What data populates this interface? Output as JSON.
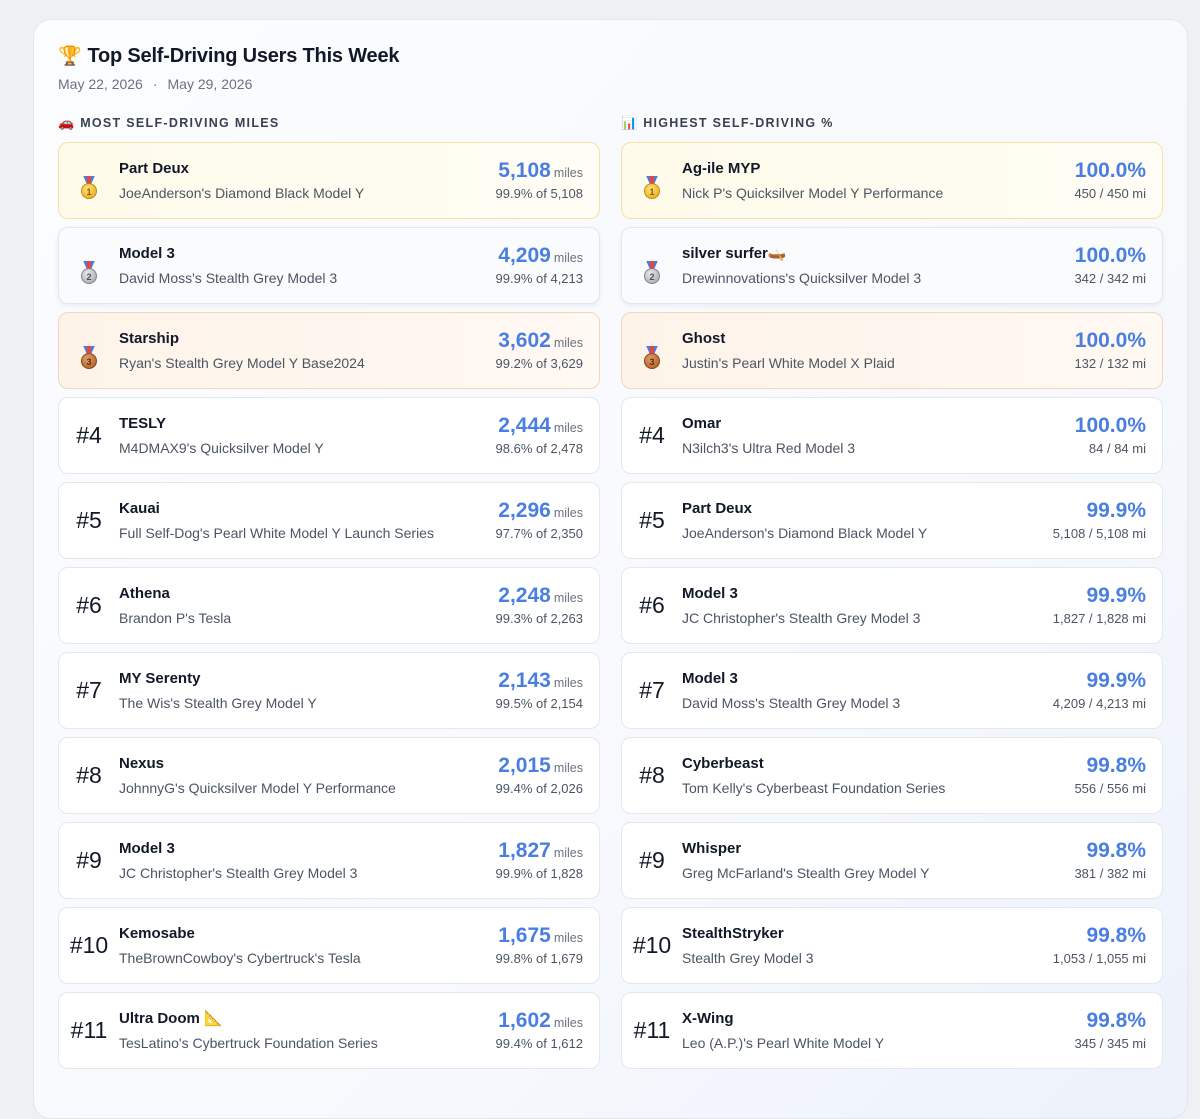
{
  "header": {
    "title": "Top Self-Driving Users This Week",
    "trophy_icon": "🏆",
    "date_start": "May 22, 2026",
    "date_sep": "·",
    "date_end": "May 29, 2026"
  },
  "miles": {
    "heading_icon": "🚗",
    "heading": "MOST SELF-DRIVING MILES",
    "unit": "miles",
    "rows": [
      {
        "rank": "1",
        "name": "Part Deux",
        "sub": "JoeAnderson's Diamond Black Model Y",
        "big": "5,108",
        "small": "99.9% of 5,108"
      },
      {
        "rank": "2",
        "name": "Model 3",
        "sub": "David Moss's Stealth Grey Model 3",
        "big": "4,209",
        "small": "99.9% of 4,213"
      },
      {
        "rank": "3",
        "name": "Starship",
        "sub": "Ryan's Stealth Grey Model Y Base2024",
        "big": "3,602",
        "small": "99.2% of 3,629"
      },
      {
        "rank": "#4",
        "name": "TESLY",
        "sub": "M4DMAX9's Quicksilver Model Y",
        "big": "2,444",
        "small": "98.6% of 2,478"
      },
      {
        "rank": "#5",
        "name": "Kauai",
        "sub": "Full Self-Dog's Pearl White Model Y Launch Series",
        "big": "2,296",
        "small": "97.7% of 2,350"
      },
      {
        "rank": "#6",
        "name": "Athena",
        "sub": "Brandon P's Tesla",
        "big": "2,248",
        "small": "99.3% of 2,263"
      },
      {
        "rank": "#7",
        "name": "MY Serenty",
        "sub": "The Wis's Stealth Grey Model Y",
        "big": "2,143",
        "small": "99.5% of 2,154"
      },
      {
        "rank": "#8",
        "name": "Nexus",
        "sub": "JohnnyG's Quicksilver Model Y Performance",
        "big": "2,015",
        "small": "99.4% of 2,026"
      },
      {
        "rank": "#9",
        "name": "Model 3",
        "sub": "JC Christopher's Stealth Grey Model 3",
        "big": "1,827",
        "small": "99.9% of 1,828"
      },
      {
        "rank": "#10",
        "name": "Kemosabe",
        "sub": "TheBrownCowboy's Cybertruck's Tesla",
        "big": "1,675",
        "small": "99.8% of 1,679"
      },
      {
        "rank": "#11",
        "name": "Ultra Doom 📐",
        "sub": "TesLatino's Cybertruck Foundation Series",
        "big": "1,602",
        "small": "99.4% of 1,612"
      }
    ]
  },
  "percent": {
    "heading_icon": "📊",
    "heading": "HIGHEST SELF-DRIVING %",
    "rows": [
      {
        "rank": "1",
        "name": "Ag-ile MYP",
        "sub": "Nick P's Quicksilver Model Y Performance",
        "big": "100.0%",
        "small": "450 / 450 mi"
      },
      {
        "rank": "2",
        "name": "silver surfer🛶",
        "sub": "Drewinnovations's Quicksilver Model 3",
        "big": "100.0%",
        "small": "342 / 342 mi"
      },
      {
        "rank": "3",
        "name": "Ghost",
        "sub": "Justin's Pearl White Model X Plaid",
        "big": "100.0%",
        "small": "132 / 132 mi"
      },
      {
        "rank": "#4",
        "name": "Omar",
        "sub": "N3ilch3's Ultra Red Model 3",
        "big": "100.0%",
        "small": "84 / 84 mi"
      },
      {
        "rank": "#5",
        "name": "Part Deux",
        "sub": "JoeAnderson's Diamond Black Model Y",
        "big": "99.9%",
        "small": "5,108 / 5,108 mi"
      },
      {
        "rank": "#6",
        "name": "Model 3",
        "sub": "JC Christopher's Stealth Grey Model 3",
        "big": "99.9%",
        "small": "1,827 / 1,828 mi"
      },
      {
        "rank": "#7",
        "name": "Model 3",
        "sub": "David Moss's Stealth Grey Model 3",
        "big": "99.9%",
        "small": "4,209 / 4,213 mi"
      },
      {
        "rank": "#8",
        "name": "Cyberbeast",
        "sub": "Tom Kelly's Cyberbeast Foundation Series",
        "big": "99.8%",
        "small": "556 / 556 mi"
      },
      {
        "rank": "#9",
        "name": "Whisper",
        "sub": "Greg McFarland's Stealth Grey Model Y",
        "big": "99.8%",
        "small": "381 / 382 mi"
      },
      {
        "rank": "#10",
        "name": "StealthStryker",
        "sub": "Stealth Grey Model 3",
        "big": "99.8%",
        "small": "1,053 / 1,055 mi"
      },
      {
        "rank": "#11",
        "name": "X-Wing",
        "sub": "Leo (A.P.)'s Pearl White Model Y",
        "big": "99.8%",
        "small": "345 / 345 mi"
      }
    ]
  },
  "colors": {
    "accent": "#4a7fe0",
    "gold_bg": "#fefbea",
    "silver_bg": "#fafbfd",
    "bronze_bg": "#fdf3e9"
  }
}
